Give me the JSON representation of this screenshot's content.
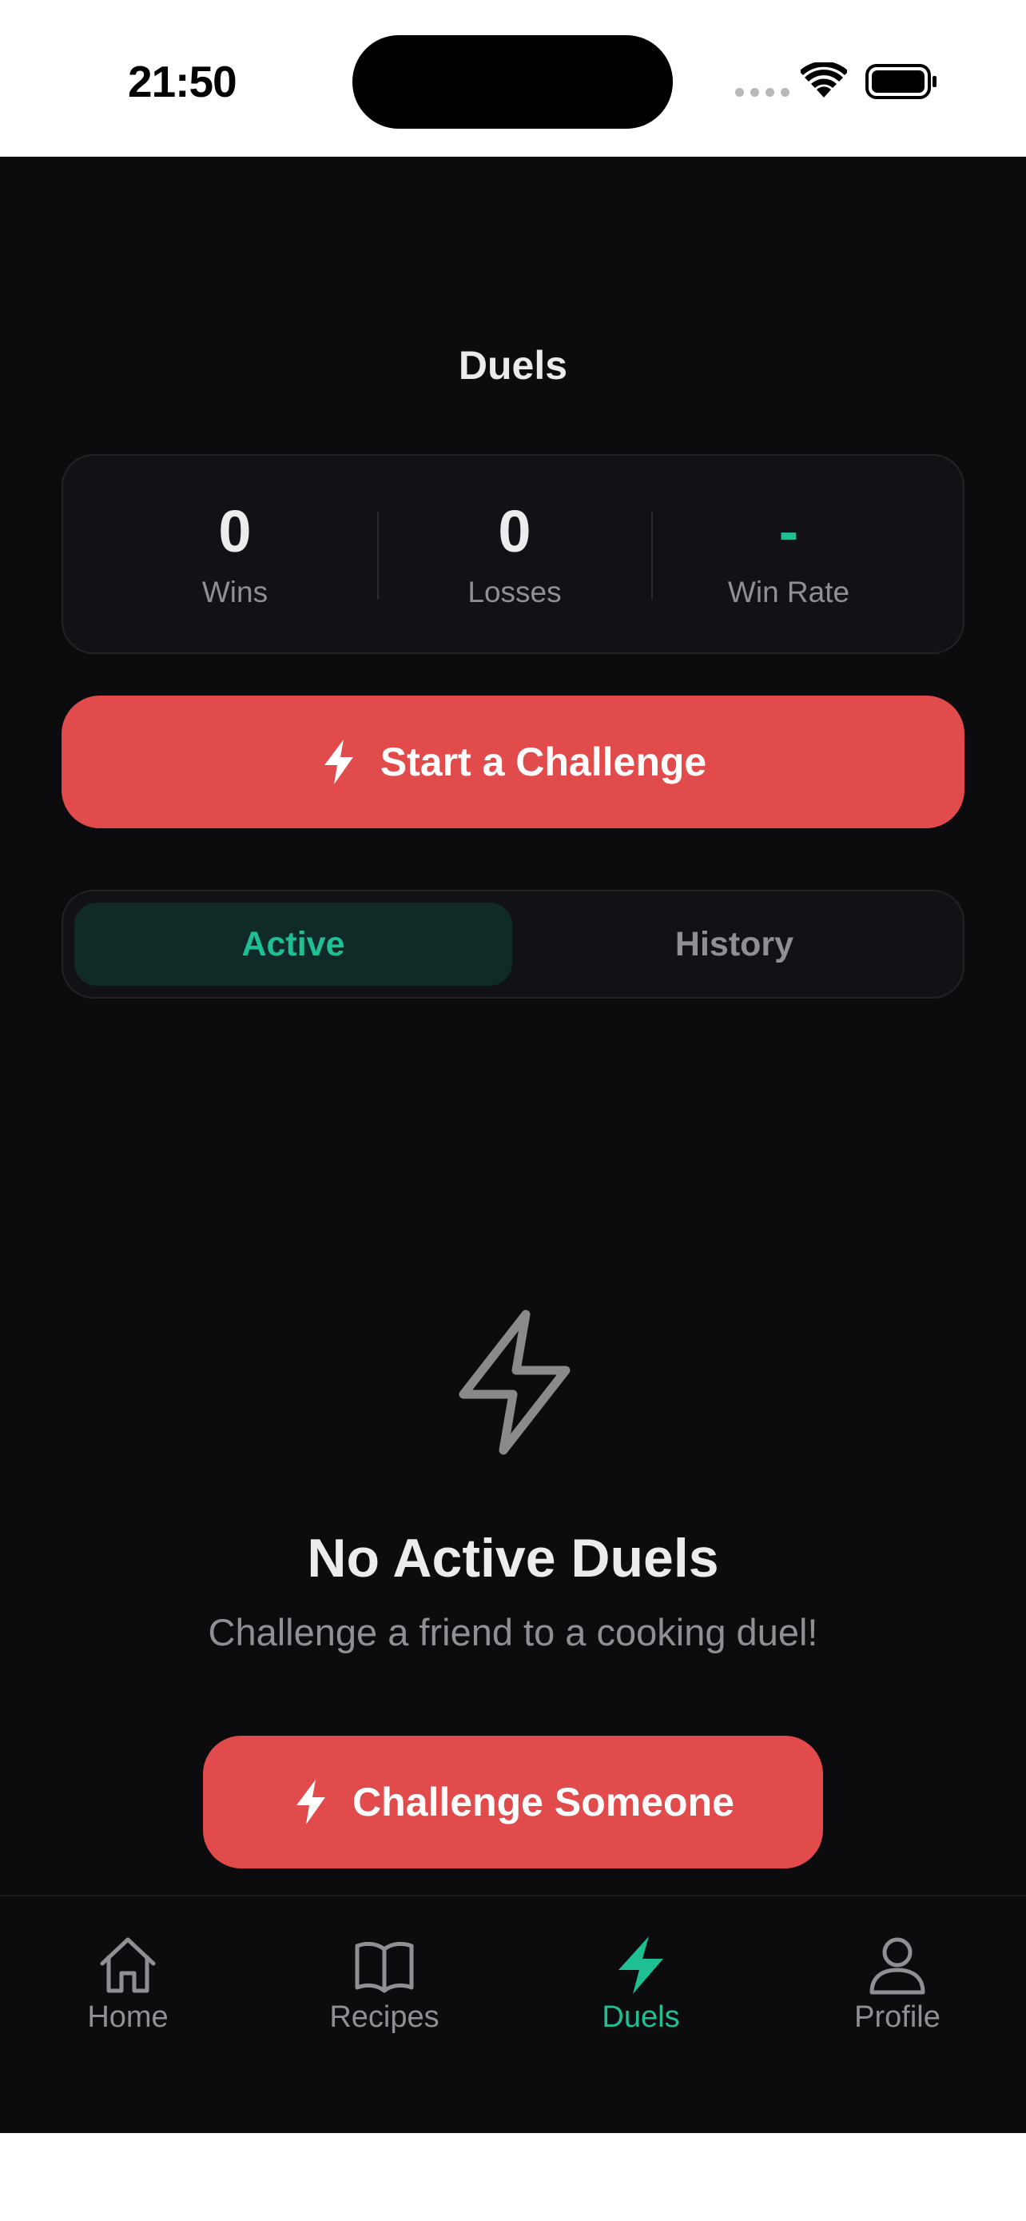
{
  "status_bar": {
    "time": "21:50"
  },
  "header": {
    "title": "Duels"
  },
  "stats": [
    {
      "value": "0",
      "label": "Wins"
    },
    {
      "value": "0",
      "label": "Losses"
    },
    {
      "value": "-",
      "label": "Win Rate"
    }
  ],
  "start_challenge": {
    "label": "Start a Challenge",
    "icon": "bolt-icon"
  },
  "segments": {
    "active": "Active",
    "history": "History",
    "selected": "Active"
  },
  "empty_state": {
    "icon": "bolt-outline-icon",
    "title": "No Active Duels",
    "subtitle": "Challenge a friend to a cooking duel!",
    "button_label": "Challenge Someone"
  },
  "tab_bar": {
    "items": [
      {
        "label": "Home",
        "icon": "home-icon"
      },
      {
        "label": "Recipes",
        "icon": "book-icon"
      },
      {
        "label": "Duels",
        "icon": "bolt-icon"
      },
      {
        "label": "Profile",
        "icon": "user-icon"
      }
    ],
    "selected": "Duels"
  },
  "colors": {
    "background": "#0c0c0f",
    "accent": "#1fbf94",
    "primary_button": "#e24b4b",
    "muted_text": "#8f8f95"
  }
}
